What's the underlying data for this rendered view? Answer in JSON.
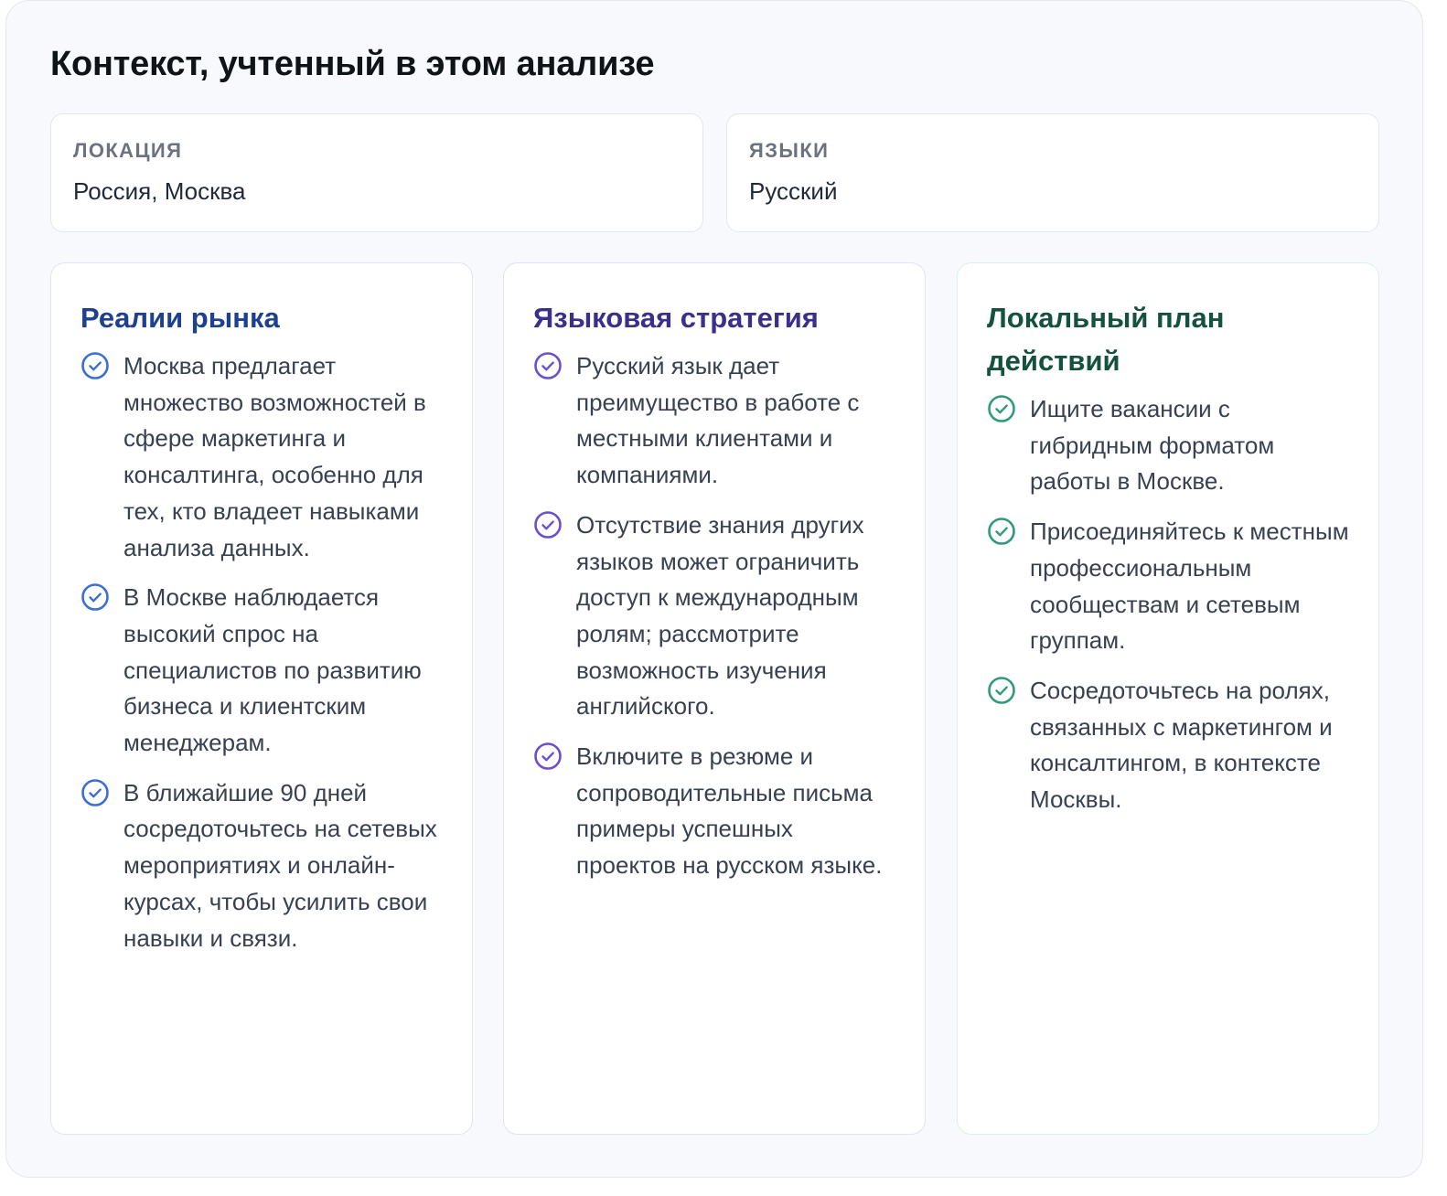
{
  "title": "Контекст, учтенный в этом анализе",
  "meta": {
    "location": {
      "label": "ЛОКАЦИЯ",
      "value": "Россия, Москва"
    },
    "languages": {
      "label": "ЯЗЫКИ",
      "value": "Русский"
    }
  },
  "colors": {
    "market": "#3b6fd4",
    "language": "#6b4fcf",
    "local": "#2f9a7c"
  },
  "columns": [
    {
      "title": "Реалии рынка",
      "items": [
        "Москва предлагает множество возможностей в сфере маркетинга и консалтинга, особенно для тех, кто владеет навыками анализа данных.",
        "В Москве наблюдается высокий спрос на специалистов по развитию бизнеса и клиентским менеджерам.",
        "В ближайшие 90 дней сосредоточьтесь на сетевых мероприятиях и онлайн-курсах, чтобы усилить свои навыки и связи."
      ]
    },
    {
      "title": "Языковая стратегия",
      "items": [
        "Русский язык дает преимущество в работе с местными клиентами и компаниями.",
        "Отсутствие знания других языков может ограничить доступ к международным ролям; рассмотрите возможность изучения английского.",
        "Включите в резюме и сопроводительные письма примеры успешных проектов на русском языке."
      ]
    },
    {
      "title": "Локальный план действий",
      "items": [
        "Ищите вакансии с гибридным форматом работы в Москве.",
        "Присоединяйтесь к местным профессиональным сообществам и сетевым группам.",
        "Сосредоточьтесь на ролях, связанных с маркетингом и консалтингом, в контексте Москвы."
      ]
    }
  ]
}
